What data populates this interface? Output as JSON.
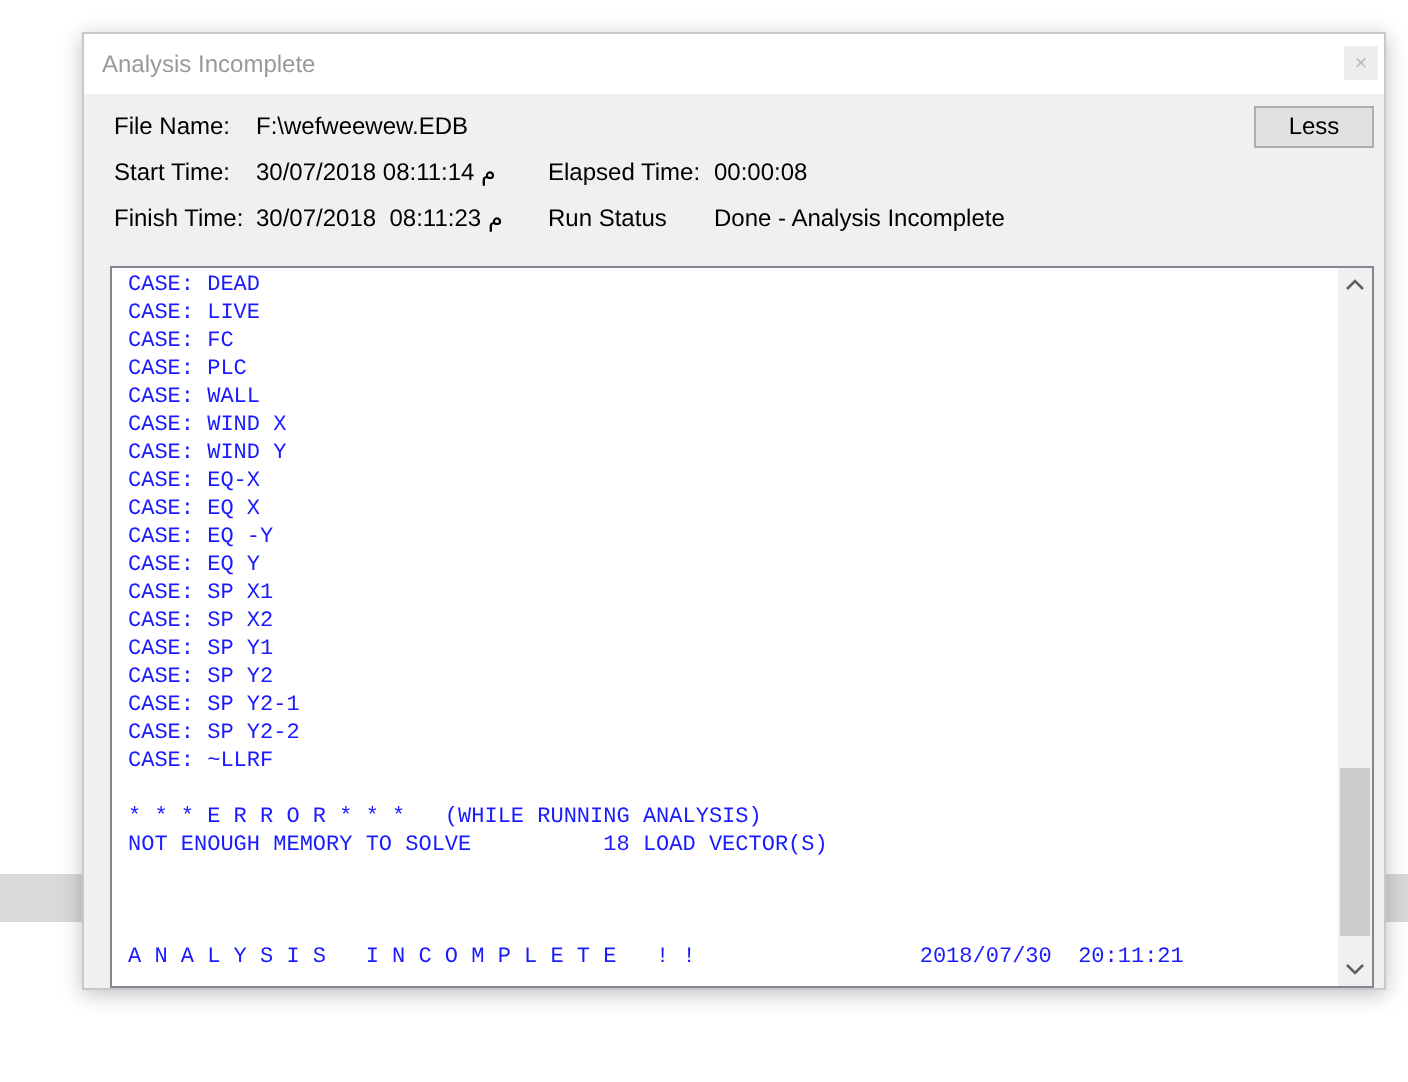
{
  "window": {
    "title": "Analysis Incomplete",
    "close": "×"
  },
  "info": {
    "rows": [
      {
        "label": "File Name:",
        "value": "F:\\wefweewew.EDB"
      },
      {
        "label": "Start Time:",
        "value": "30/07/2018 08:11:14 م",
        "label2": "Elapsed Time:",
        "value2": "00:00:08"
      },
      {
        "label": "Finish Time:",
        "value": "30/07/2018  08:11:23 م",
        "label2": "Run Status",
        "value2": "Done - Analysis Incomplete"
      }
    ],
    "button": "Less"
  },
  "log": {
    "sections": [
      {
        "kind": "cases",
        "lines": [
          "CASE: DEAD",
          "CASE: LIVE",
          "CASE: FC",
          "CASE: PLC",
          "CASE: WALL",
          "CASE: WIND X",
          "CASE: WIND Y",
          "CASE: EQ-X",
          "CASE: EQ X",
          "CASE: EQ -Y",
          "CASE: EQ Y",
          "CASE: SP X1",
          "CASE: SP X2",
          "CASE: SP Y1",
          "CASE: SP Y2",
          "CASE: SP Y2-1",
          "CASE: SP Y2-2",
          "CASE: ~LLRF"
        ]
      },
      {
        "kind": "error",
        "lines": [
          "* * * E R R O R * * *   (WHILE RUNNING ANALYSIS)",
          "NOT ENOUGH MEMORY TO SOLVE          18 LOAD VECTOR(S)"
        ]
      },
      {
        "kind": "summary",
        "message": "A N A L Y S I S   I N C O M P L E T E   ! !",
        "timestamp": "2018/07/30  20:11:21"
      }
    ]
  }
}
